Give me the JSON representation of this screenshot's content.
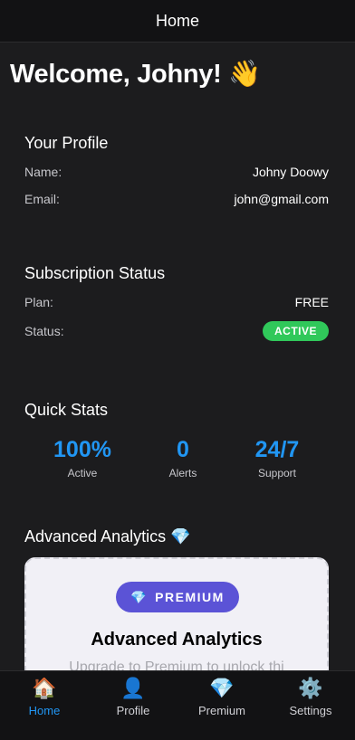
{
  "nav": {
    "title": "Home"
  },
  "welcome": {
    "text": "Welcome, Johny! 👋"
  },
  "profile": {
    "title": "Your Profile",
    "name_label": "Name:",
    "name_value": "Johny Doowy",
    "email_label": "Email:",
    "email_value": "john@gmail.com"
  },
  "subscription": {
    "title": "Subscription Status",
    "plan_label": "Plan:",
    "plan_value": "FREE",
    "status_label": "Status:",
    "status_value": "ACTIVE",
    "status_color": "#30c85a"
  },
  "stats": {
    "title": "Quick Stats",
    "items": [
      {
        "value": "100%",
        "label": "Active"
      },
      {
        "value": "0",
        "label": "Alerts"
      },
      {
        "value": "24/7",
        "label": "Support"
      }
    ],
    "accent": "#2196f3"
  },
  "analytics": {
    "title": "Advanced Analytics 💎",
    "badge": "PREMIUM",
    "badge_icon": "💎",
    "card_title": "Advanced Analytics",
    "card_desc": "Upgrade to Premium to unlock thi"
  },
  "tabs": [
    {
      "icon": "🏠",
      "icon_name": "home-icon",
      "label": "Home",
      "active": true
    },
    {
      "icon": "👤",
      "icon_name": "profile-icon",
      "label": "Profile",
      "active": false
    },
    {
      "icon": "💎",
      "icon_name": "gem-icon",
      "label": "Premium",
      "active": false
    },
    {
      "icon": "⚙️",
      "icon_name": "gear-icon",
      "label": "Settings",
      "active": false
    }
  ]
}
